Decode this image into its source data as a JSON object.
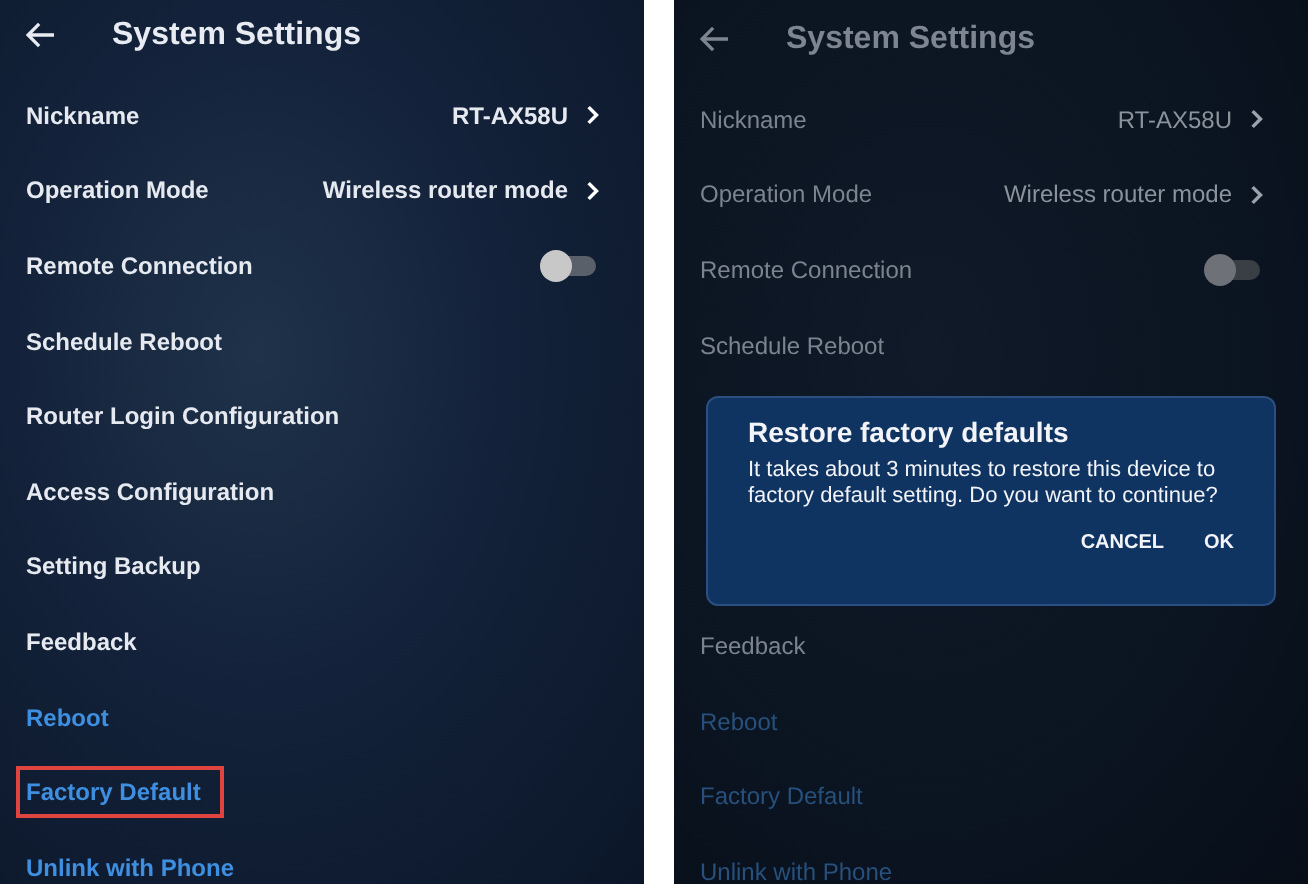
{
  "screens": [
    {
      "title": "System Settings",
      "dimmed": false,
      "items": [
        {
          "kind": "link",
          "label": "Nickname",
          "value": "RT-AX58U",
          "highlighted": false
        },
        {
          "kind": "link",
          "label": "Operation Mode",
          "value": "Wireless router mode",
          "highlighted": false
        },
        {
          "kind": "toggle",
          "label": "Remote Connection",
          "on": false,
          "highlighted": false
        },
        {
          "kind": "plain",
          "label": "Schedule Reboot",
          "highlighted": false
        },
        {
          "kind": "plain",
          "label": "Router Login Configuration",
          "highlighted": false
        },
        {
          "kind": "plain",
          "label": "Access Configuration",
          "highlighted": false
        },
        {
          "kind": "plain",
          "label": "Setting Backup",
          "highlighted": false
        },
        {
          "kind": "plain",
          "label": "Feedback",
          "highlighted": false
        },
        {
          "kind": "action",
          "label": "Reboot",
          "highlighted": false
        },
        {
          "kind": "action",
          "label": "Factory Default",
          "highlighted": true
        },
        {
          "kind": "action",
          "label": "Unlink with Phone",
          "highlighted": false
        }
      ]
    },
    {
      "title": "System Settings",
      "dimmed": true,
      "items": [
        {
          "kind": "link",
          "label": "Nickname",
          "value": "RT-AX58U",
          "highlighted": false
        },
        {
          "kind": "link",
          "label": "Operation Mode",
          "value": "Wireless router mode",
          "highlighted": false
        },
        {
          "kind": "toggle",
          "label": "Remote Connection",
          "on": false,
          "highlighted": false
        },
        {
          "kind": "plain",
          "label": "Schedule Reboot",
          "highlighted": false
        },
        {
          "kind": "dialog",
          "title": "Restore factory defaults",
          "message": "It takes about 3 minutes to restore this device to factory default setting. Do you want to continue?",
          "buttons": [
            "CANCEL",
            "OK"
          ]
        },
        {
          "kind": "plain",
          "label": "Feedback",
          "highlighted": false
        },
        {
          "kind": "action",
          "label": "Reboot",
          "highlighted": false
        },
        {
          "kind": "action",
          "label": "Factory Default",
          "highlighted": false
        },
        {
          "kind": "action",
          "label": "Unlink with Phone",
          "highlighted": false
        }
      ]
    }
  ]
}
